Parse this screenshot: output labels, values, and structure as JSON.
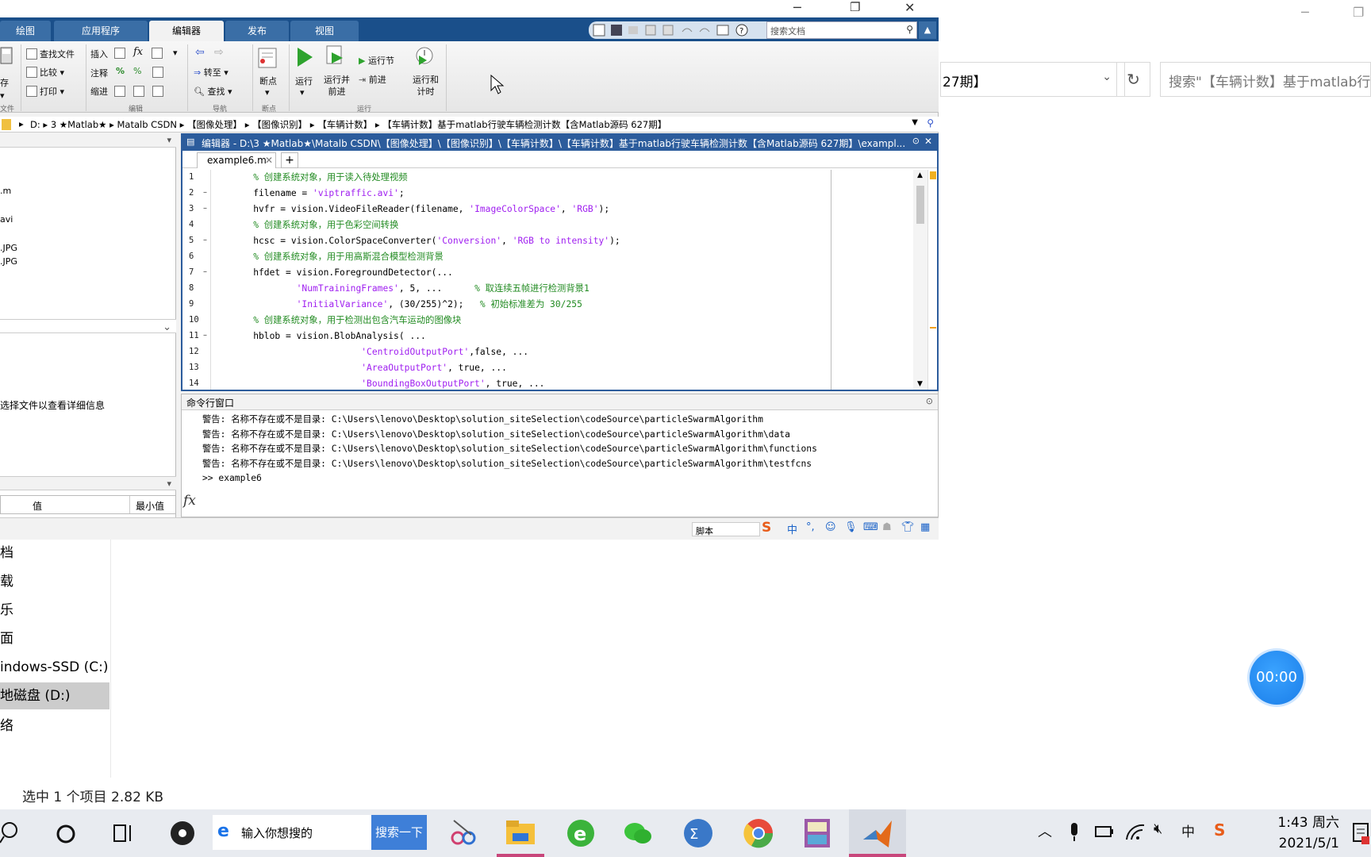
{
  "window_controls": {
    "minimize": "─",
    "maximize": "❐",
    "close": "✕"
  },
  "explorer": {
    "address_text": "27期】",
    "address_chevron": "⌄",
    "refresh": "↻",
    "search_placeholder": "搜索\"【车辆计数】基于matlab行",
    "nav_items": [
      "档",
      "载",
      "乐",
      "面",
      "indows-SSD (C:)",
      "地磁盘 (D:)",
      "络"
    ],
    "status": "选中 1 个项目  2.82 KB"
  },
  "timer": "00:00",
  "matlab": {
    "tabs": [
      "绘图",
      "应用程序",
      "编辑器",
      "发布",
      "视图"
    ],
    "active_tab": "编辑器",
    "doc_search_placeholder": "搜索文档",
    "ribbon": {
      "file_group": {
        "save": "存",
        "label": "文件"
      },
      "find_file": "查找文件",
      "compare": "比较",
      "print": "打印",
      "insert": "插入",
      "fx": "fx",
      "comment": "注释",
      "indent": "缩进",
      "goto": "转至",
      "find": "查找",
      "breakpoints": "断点",
      "run": "运行",
      "run_advance": "运行并\n前进",
      "run_section": "运行节",
      "advance": "前进",
      "run_time": "运行和\n计时",
      "groups": {
        "edit": "编辑",
        "nav": "导航",
        "bp": "断点",
        "run": "运行"
      }
    },
    "breadcrumb": "D:  ▸  3 ★Matlab★  ▸  Matalb CSDN  ▸  【图像处理】  ▸  【图像识别】  ▸  【车辆计数】  ▸  【车辆计数】基于matlab行驶车辆检测计数【含Matlab源码 627期】",
    "left_panel": {
      "files": [
        ".m",
        "avi",
        ".JPG",
        ".JPG"
      ],
      "details_hint": "选择文件以查看详细信息",
      "ws_col_value": "值",
      "ws_col_min": "最小值"
    },
    "editor": {
      "title": "编辑器 - D:\\3 ★Matlab★\\Matalb CSDN\\【图像处理】\\【图像识别】\\【车辆计数】\\【车辆计数】基于matlab行驶车辆检测计数【含Matlab源码 627期】\\exampl...",
      "tab": "example6.m",
      "plus": "+",
      "lines": [
        {
          "n": "1",
          "dash": "",
          "segs": [
            {
              "t": "    % 创建系统对象，用于读入待处理视频",
              "c": "cm"
            }
          ]
        },
        {
          "n": "2",
          "dash": "–",
          "segs": [
            {
              "t": "    filename = ",
              "c": ""
            },
            {
              "t": "'viptraffic.avi'",
              "c": "st"
            },
            {
              "t": ";",
              "c": ""
            }
          ]
        },
        {
          "n": "3",
          "dash": "–",
          "segs": [
            {
              "t": "    hvfr = vision.VideoFileReader(filename, ",
              "c": ""
            },
            {
              "t": "'ImageColorSpace'",
              "c": "st"
            },
            {
              "t": ", ",
              "c": ""
            },
            {
              "t": "'RGB'",
              "c": "st"
            },
            {
              "t": ");",
              "c": ""
            }
          ]
        },
        {
          "n": "4",
          "dash": "",
          "segs": [
            {
              "t": "    % 创建系统对象，用于色彩空间转换",
              "c": "cm"
            }
          ]
        },
        {
          "n": "5",
          "dash": "–",
          "segs": [
            {
              "t": "    hcsc = vision.ColorSpaceConverter(",
              "c": ""
            },
            {
              "t": "'Conversion'",
              "c": "st"
            },
            {
              "t": ", ",
              "c": ""
            },
            {
              "t": "'RGB to intensity'",
              "c": "st"
            },
            {
              "t": ");",
              "c": ""
            }
          ]
        },
        {
          "n": "6",
          "dash": "",
          "segs": [
            {
              "t": "    % 创建系统对象，用于用高斯混合模型检测背景",
              "c": "cm"
            }
          ]
        },
        {
          "n": "7",
          "dash": "–",
          "segs": [
            {
              "t": "    hfdet = vision.ForegroundDetector(...",
              "c": ""
            }
          ]
        },
        {
          "n": "8",
          "dash": "",
          "segs": [
            {
              "t": "            ",
              "c": ""
            },
            {
              "t": "'NumTrainingFrames'",
              "c": "st"
            },
            {
              "t": ", 5, ...      ",
              "c": ""
            },
            {
              "t": "% 取连续五帧进行检测背景1",
              "c": "cm"
            }
          ]
        },
        {
          "n": "9",
          "dash": "",
          "segs": [
            {
              "t": "            ",
              "c": ""
            },
            {
              "t": "'InitialVariance'",
              "c": "st"
            },
            {
              "t": ", (30/255)^2);   ",
              "c": ""
            },
            {
              "t": "% 初始标准差为 30/255",
              "c": "cm"
            }
          ]
        },
        {
          "n": "10",
          "dash": "",
          "segs": [
            {
              "t": "    % 创建系统对象，用于检测出包含汽车运动的图像块",
              "c": "cm"
            }
          ]
        },
        {
          "n": "11",
          "dash": "–",
          "segs": [
            {
              "t": "    hblob = vision.BlobAnalysis( ...",
              "c": ""
            }
          ]
        },
        {
          "n": "12",
          "dash": "",
          "segs": [
            {
              "t": "                        ",
              "c": ""
            },
            {
              "t": "'CentroidOutputPort'",
              "c": "st"
            },
            {
              "t": ",false, ...",
              "c": ""
            }
          ]
        },
        {
          "n": "13",
          "dash": "",
          "segs": [
            {
              "t": "                        ",
              "c": ""
            },
            {
              "t": "'AreaOutputPort'",
              "c": "st"
            },
            {
              "t": ", true, ...",
              "c": ""
            }
          ]
        },
        {
          "n": "14",
          "dash": "",
          "segs": [
            {
              "t": "                        ",
              "c": ""
            },
            {
              "t": "'BoundingBoxOutputPort'",
              "c": "st"
            },
            {
              "t": ", true, ...",
              "c": ""
            }
          ]
        }
      ]
    },
    "command_window": {
      "title": "命令行窗口",
      "lines": [
        "警告: 名称不存在或不是目录: C:\\Users\\lenovo\\Desktop\\solution_siteSelection\\codeSource\\particleSwarmAlgorithm",
        "警告: 名称不存在或不是目录: C:\\Users\\lenovo\\Desktop\\solution_siteSelection\\codeSource\\particleSwarmAlgorithm\\data",
        "警告: 名称不存在或不是目录: C:\\Users\\lenovo\\Desktop\\solution_siteSelection\\codeSource\\particleSwarmAlgorithm\\functions",
        "警告: 名称不存在或不是目录: C:\\Users\\lenovo\\Desktop\\solution_siteSelection\\codeSource\\particleSwarmAlgorithm\\testfcns",
        ">> example6"
      ],
      "fx": "fx"
    },
    "status_mode": "脚本",
    "ime_zh": "中"
  },
  "taskbar": {
    "search_placeholder": "输入你想搜的",
    "search_button": "搜索一下",
    "ie_glyph": "e",
    "ime_lang": "中",
    "time": "1:43 周六",
    "date": "2021/5/1"
  },
  "colors": {
    "matlab_blue": "#1a4f8a",
    "editor_blue": "#2c5c9c",
    "comment": "#228b22",
    "string": "#a020f0",
    "taskbar_accent": "#c8467b"
  }
}
